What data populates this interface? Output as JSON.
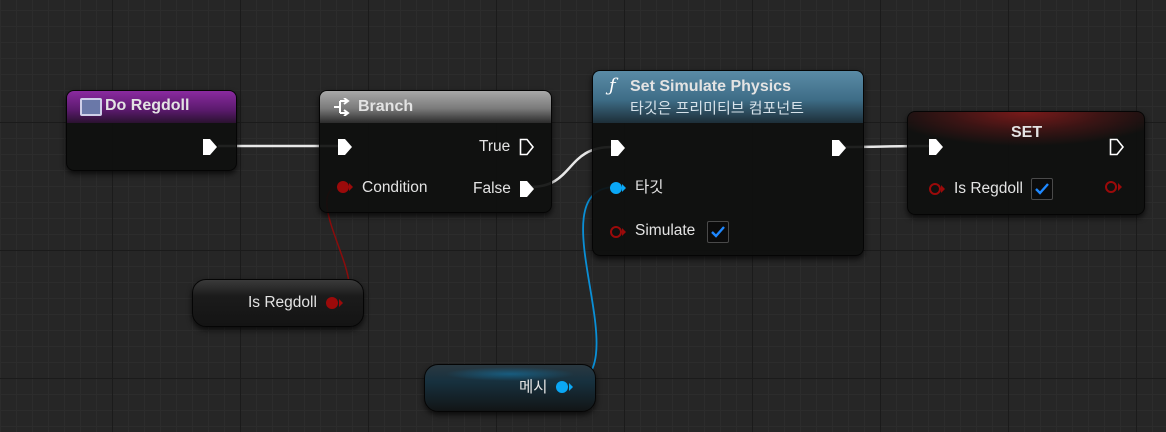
{
  "nodes": {
    "do_regdoll": {
      "title": "Do Regdoll"
    },
    "branch": {
      "title": "Branch",
      "true_label": "True",
      "condition_label": "Condition",
      "false_label": "False"
    },
    "set_simulate_physics": {
      "title": "Set Simulate Physics",
      "subtitle": "타깃은 프리미티브 컴포넌트",
      "target_label": "타깃",
      "simulate_label": "Simulate",
      "simulate_checked": true
    },
    "set": {
      "title": "SET",
      "var_label": "Is Regdoll",
      "var_checked": true
    },
    "get_is_regdoll": {
      "label": "Is Regdoll"
    },
    "get_mesh": {
      "label": "메시"
    }
  },
  "colors": {
    "bool_pin": "#9b0a0a",
    "object_pin": "#0aa7f5",
    "exec_pin": "#ffffff",
    "event_header": "#6b1f7f",
    "pure_function_header": "#3d6b85",
    "checkbox_check": "#1e88ff"
  },
  "icons": {
    "event": "event-icon",
    "branch": "branch-icon",
    "function": "function-icon"
  }
}
